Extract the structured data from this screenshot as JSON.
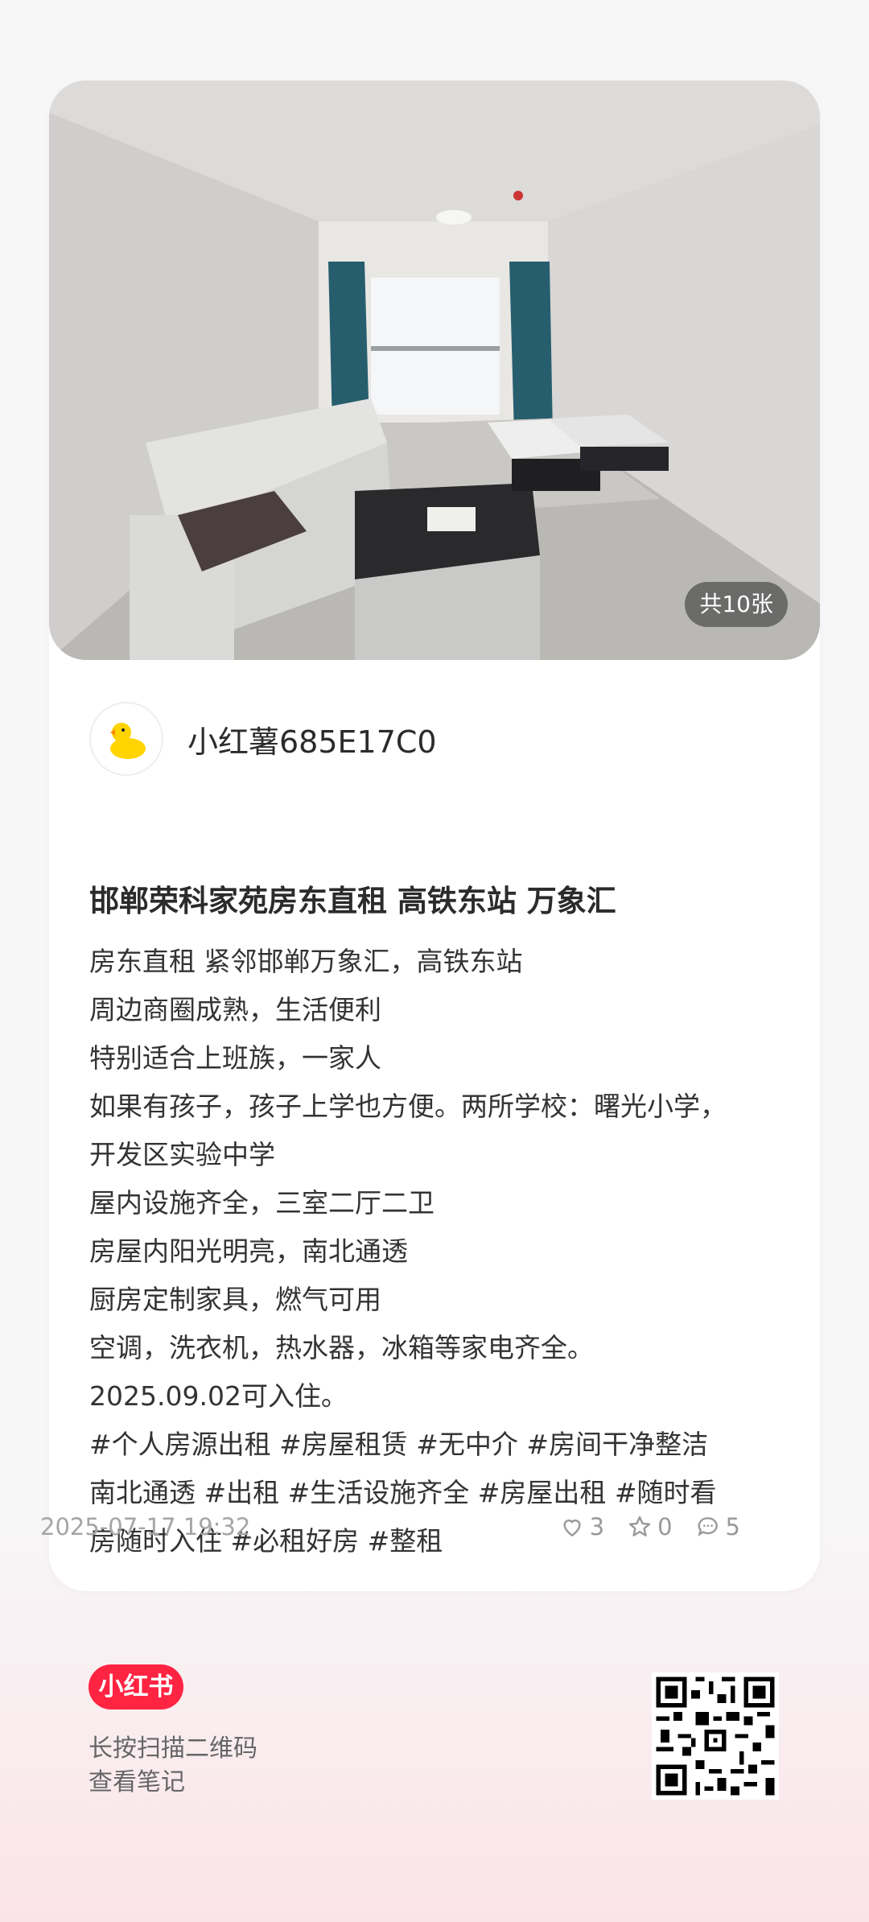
{
  "photo": {
    "count_label": "共10张"
  },
  "author": {
    "name": "小红薯685E17C0",
    "avatar_icon": "duck-avatar-icon"
  },
  "post": {
    "title": "邯郸荣科家苑房东直租 高铁东站 万象汇",
    "lines": [
      "房东直租 紧邻邯郸万象汇，高铁东站",
      "周边商圈成熟，生活便利",
      "特别适合上班族，一家人",
      "如果有孩子，孩子上学也方便。两所学校：曙光小学，",
      "开发区实验中学",
      "屋内设施齐全，三室二厅二卫",
      "房屋内阳光明亮，南北通透",
      "厨房定制家具，燃气可用",
      "空调，洗衣机，热水器，冰箱等家电齐全。",
      "2025.09.02可入住。",
      "#个人房源出租  #房屋租赁 #无中介     #房间干净整洁",
      "南北通透  #出租  #生活设施齐全  #房屋出租  #随时看",
      "房随时入住  #必租好房 #整租"
    ],
    "date": "2025-07-17 19:32",
    "likes": "3",
    "collects": "0",
    "comments": "5"
  },
  "footer": {
    "logo": "小红书",
    "hint_line1": "长按扫描二维码",
    "hint_line2": "查看笔记"
  },
  "colors": {
    "brand": "#ff2442",
    "text": "#2b2b2b",
    "muted": "#a5a5a5"
  }
}
